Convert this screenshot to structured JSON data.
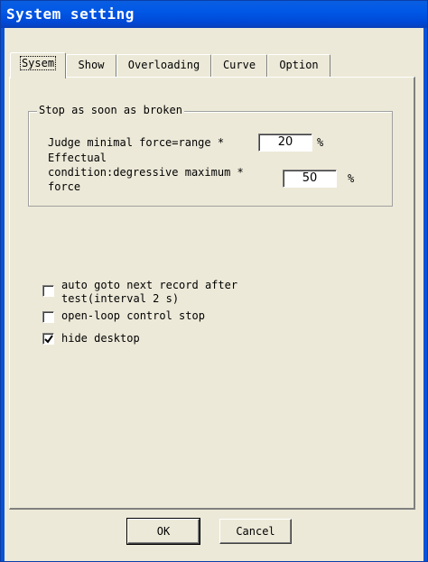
{
  "window": {
    "title": "System setting"
  },
  "tabs": [
    {
      "label": "Sysem",
      "active": true
    },
    {
      "label": "Show"
    },
    {
      "label": "Overloading"
    },
    {
      "label": "Curve"
    },
    {
      "label": "Option"
    }
  ],
  "group": {
    "title": "Stop as soon as broken",
    "judge_label": "Judge minimal force=range *",
    "judge_value": "20",
    "judge_unit": "%",
    "effectual_line1": "Effectual",
    "effectual_line2": "condition:degressive maximum *",
    "effectual_line3": "force",
    "effectual_value": "50",
    "effectual_unit": "%"
  },
  "options": [
    {
      "label_line1": "auto goto next record after",
      "label_line2": "test(interval 2 s)",
      "checked": false
    },
    {
      "label_line1": "open-loop control stop",
      "checked": false
    },
    {
      "label_line1": "hide desktop",
      "checked": true
    }
  ],
  "buttons": {
    "ok": "OK",
    "cancel": "Cancel"
  }
}
